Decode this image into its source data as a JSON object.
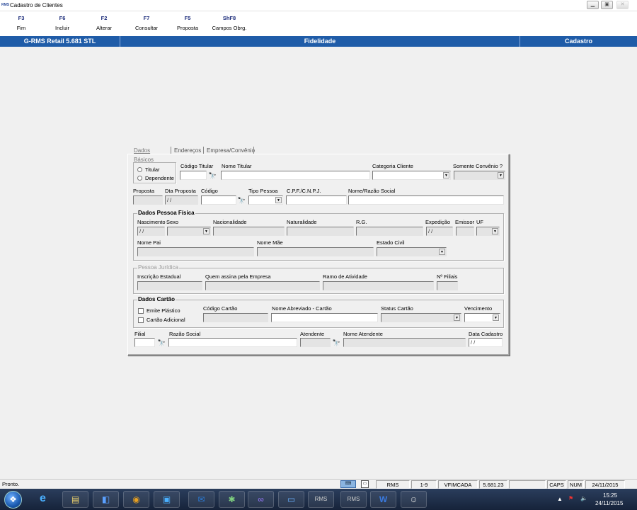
{
  "window": {
    "title": "Cadastro de Clientes"
  },
  "toolbar": [
    {
      "key": "F3",
      "label": "Fim"
    },
    {
      "key": "F6",
      "label": "Incluir"
    },
    {
      "key": "F2",
      "label": "Alterar"
    },
    {
      "key": "F7",
      "label": "Consultar"
    },
    {
      "key": "F5",
      "label": "Proposta"
    },
    {
      "key": "ShF8",
      "label": "Campos Obrg."
    }
  ],
  "header": {
    "product": "G-RMS Retail 5.681 STL",
    "module": "Fidelidade",
    "section": "Cadastro"
  },
  "tabs": [
    "Dados Básicos",
    "Endereços",
    "Empresa/Convênio"
  ],
  "titular": {
    "radio_titular": "Titular",
    "radio_dependente": "Dependente",
    "codigo_titular": "Código Titular",
    "nome_titular": "Nome Titular",
    "categoria_cliente": "Categoria Cliente",
    "somente_convenio": "Somente Convênio ?"
  },
  "proposta_row": {
    "proposta": "Proposta",
    "dta_proposta": "Dta Proposta",
    "dta_proposta_value": " / /",
    "codigo": "Código",
    "tipo_pessoa": "Tipo Pessoa",
    "cpf_cnpj": "C.P.F./C.N.P.J.",
    "nome_razao": "Nome/Razão Social"
  },
  "pessoa_fisica": {
    "title": "Dados Pessoa Física",
    "nascimento": "Nascimento",
    "nascimento_value": " / /",
    "sexo": "Sexo",
    "nacionalidade": "Nacionalidade",
    "naturalidade": "Naturalidade",
    "rg": "R.G.",
    "expedicao": "Expedição",
    "expedicao_value": " / /",
    "emissor": "Emissor",
    "uf": "UF",
    "nome_pai": "Nome Pai",
    "nome_mae": "Nome Mãe",
    "estado_civil": "Estado Civil"
  },
  "pessoa_juridica": {
    "title": "Pessoa Jurídica",
    "inscricao": "Inscrição Estadual",
    "quem_assina": "Quem assina pela Empresa",
    "ramo": "Ramo de Atividade",
    "filiais": "Nº Filiais"
  },
  "cartao": {
    "title": "Dados Cartão",
    "emite_plastico": "Emite Plástico",
    "cartao_adicional": "Cartão Adicional",
    "codigo_cartao": "Código Cartão",
    "nome_abreviado": "Nome Abreviado - Cartão",
    "status_cartao": "Status Cartão",
    "vencimento": "Vencimento"
  },
  "footer_row": {
    "filial": "Filial",
    "razao_social": "Razão Social",
    "atendente": "Atendente",
    "nome_atendente": "Nome Atendente",
    "data_cadastro": "Data Cadastro",
    "data_cadastro_value": " / /"
  },
  "statusbar": {
    "status": "Pronto.",
    "app": "RMS",
    "page": "1-9",
    "program": "VFIMCADA",
    "version": "5.681.23",
    "caps": "CAPS",
    "num": "NUM",
    "date": "24/11/2015"
  },
  "taskbar": {
    "time": "15:25",
    "date": "24/11/2015"
  },
  "colors": {
    "header_blue": "#1f5ca8",
    "toolbar_key": "#1a2a7a"
  }
}
